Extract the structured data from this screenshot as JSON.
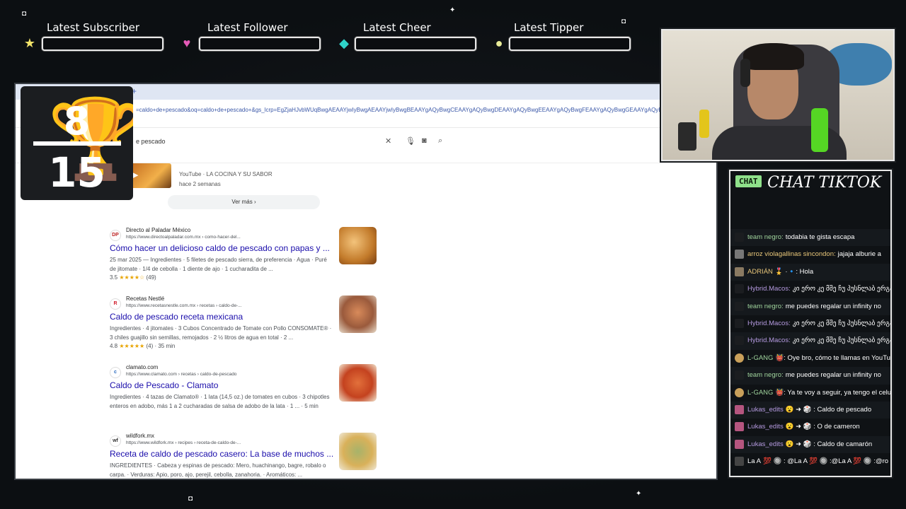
{
  "alerts": [
    {
      "label": "Latest Subscriber",
      "icon": "star-icon",
      "color": "#f2e36a"
    },
    {
      "label": "Latest Follower",
      "icon": "heart-icon",
      "color": "#e45ab7"
    },
    {
      "label": "Latest Cheer",
      "icon": "gem-icon",
      "color": "#2fd3c9"
    },
    {
      "label": "Latest Tipper",
      "icon": "coin-icon",
      "color": "#e8eb98"
    }
  ],
  "score": {
    "current": "8",
    "total": "15"
  },
  "browser": {
    "url": "=caldo+de+pescado&oq=caldo+de+pescado+&gs_lcrp=EgZjaHJvbWUqBwgAEAAYjwIyBwgAEAAYjwIyBwgBEAAYgAQyBwgCEAAYgAQyBwgDEAAYgAQyBwgEEAAYgAQyBwgFEAAYgAQyBwgGEAAYgAQyBwgHEAAYgAQyBwgIEAAYgAQyBwgJEAAYgAQyBwgKEAAYgAQyBwgL",
    "search_query": "e pescado",
    "video_source": "YouTube · LA COCINA Y SU SABOR",
    "video_when": "hace 2 semanas",
    "ver_mas": "Ver más"
  },
  "results": [
    {
      "site": "Directo al Paladar México",
      "path": "https://www.directoalpaladar.com.mx › como-hacer-del...",
      "title": "Cómo hacer un delicioso caldo de pescado con papas y ...",
      "snippet": "25 mar 2025 — Ingredientes · 5 filetes de pescado sierra, de preferencia · Agua · Puré de jitomate · 1/4 de cebolla · 1 diente de ajo · 1 cucharadita de ...",
      "rating": "3.5",
      "stars": "★★★★☆",
      "reviews": "(49)",
      "fav": "DP",
      "thumb_color": "#c27a2a"
    },
    {
      "site": "Recetas Nestlé",
      "path": "https://www.recetasnestle.com.mx › recetas › caldo-de-...",
      "title": "Caldo de pescado receta mexicana",
      "snippet": "Ingredientes · 4 jitomates · 3 Cubos Concentrado de Tomate con Pollo CONSOMATE® · 3 chiles guajillo sin semillas, remojados · 2 ½ litros de agua en total · 2 ...",
      "rating": "4.8",
      "stars": "★★★★★",
      "reviews": "(4) · 35 min",
      "fav": "R",
      "thumb_color": "#9a5a3c"
    },
    {
      "site": "clamato.com",
      "path": "https://www.clamato.com › recetas › caldo-de-pescado",
      "title": "Caldo de Pescado - Clamato",
      "snippet": "Ingredientes · 4 tazas de Clamato® · 1 lata (14,5 oz.) de tomates en cubos · 3 chipotles enteros en adobo, más 1 a 2 cucharadas de salsa de adobo de la lata · 1 ... · 5 min",
      "rating": "",
      "stars": "",
      "reviews": "",
      "fav": "c",
      "thumb_color": "#c4421f"
    },
    {
      "site": "wildfork.mx",
      "path": "https://www.wildfork.mx › recipes › receta-de-caldo-de-...",
      "title": "Receta de caldo de pescado casero: La base de muchos ...",
      "snippet": "INGREDIENTES · Cabeza y espinas de pescado: Mero, huachinango, bagre, robalo o carpa. · Verduras: Apio, poro, ajo, perejil, cebolla, zanahoria. · Aromáticos: ...",
      "rating": "",
      "stars": "",
      "reviews": "",
      "fav": "wf",
      "thumb_color": "#d9b15a"
    }
  ],
  "chat": {
    "badge": "CHAT",
    "title": "CHAT TIKTOK",
    "messages": [
      {
        "user": "team negro:",
        "text": "todabia te gista escapa",
        "color": "green"
      },
      {
        "user": "arroz violagallinas sincondon:",
        "text": "jajaja alburie a",
        "color": "gold"
      },
      {
        "user": "ADRIÁN",
        "text": "🎖️ ·🔹: Hola",
        "color": "gold"
      },
      {
        "user": "Hybrid.Macos:",
        "text": "კი ერო კე მშე ჩუ პუსნლაბ ერგა",
        "color": "purple"
      },
      {
        "user": "team negro:",
        "text": "me puedes regalar un infinity no",
        "color": "green"
      },
      {
        "user": "Hybrid.Macos:",
        "text": "კი ერო კე მშე ჩუ პუსნლაბ ერგა",
        "color": "purple"
      },
      {
        "user": "Hybrid.Macos:",
        "text": "კი ერო კე მშე ჩუ პუსნლაბ ერგა",
        "color": "purple"
      },
      {
        "user": "L-GANG",
        "text": "👹: Oye bro, cómo te llamas en YouTu",
        "color": "green"
      },
      {
        "user": "team negro:",
        "text": "me puedes regalar un infinity no",
        "color": "green"
      },
      {
        "user": "L-GANG",
        "text": "👹: Ya te voy a seguir, ya tengo el celu",
        "color": "green"
      },
      {
        "user": "Lukas_edits",
        "text": "😮 ➜ 🎲 : Caldo de pescado",
        "color": "purple"
      },
      {
        "user": "Lukas_edits",
        "text": "😮 ➜ 🎲 : O de cameron",
        "color": "purple"
      },
      {
        "user": "Lukas_edits",
        "text": "😮 ➜ 🎲 : Caldo de camarón",
        "color": "purple"
      },
      {
        "user": "La A",
        "text": "💯 🔘 : @La A 💯 🔘 :@La A 💯 🔘 :@ro",
        "color": "white"
      }
    ]
  }
}
